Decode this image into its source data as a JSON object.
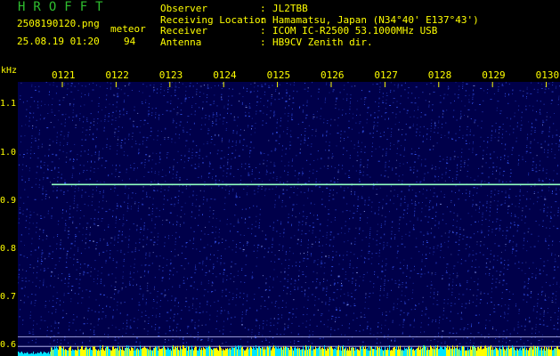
{
  "header": {
    "title": "HROFFT",
    "filename": "2508190120.png",
    "datetime": "25.08.19 01:20",
    "meteor_label": "meteor",
    "meteor_count": "94",
    "info": [
      {
        "key": "Observer",
        "value": "JL2TBB"
      },
      {
        "key": "Receiving Location",
        "value": "Hamamatsu, Japan (N34°40' E137°43')"
      },
      {
        "key": "Receiver",
        "value": "ICOM IC-R2500 53.1000MHz USB"
      },
      {
        "key": "Antenna",
        "value": "HB9CV Zenith dir."
      }
    ]
  },
  "axes": {
    "unit": "kHz",
    "time_ticks": [
      "0121",
      "0122",
      "0123",
      "0124",
      "0125",
      "0126",
      "0127",
      "0128",
      "0129",
      "0130"
    ],
    "freq_ticks": [
      "1.1",
      "1.0",
      "0.9",
      "0.8",
      "0.7",
      "0.6"
    ]
  },
  "colors": {
    "background": "#00004a",
    "noise": "#3a5cff",
    "trace": "#8fffc0",
    "text": "#ffff00",
    "title": "#2fbf2f"
  },
  "trace": {
    "freq_khz": 0.934,
    "start_time": "0121",
    "end_time": "0130"
  }
}
